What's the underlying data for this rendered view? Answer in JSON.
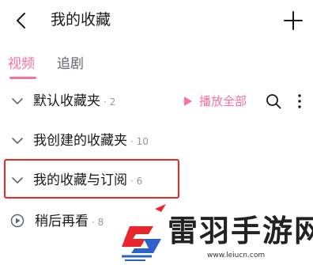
{
  "header": {
    "title": "我的收藏",
    "back_icon": "chevron-left-icon",
    "add_icon": "plus-icon"
  },
  "tabs": [
    {
      "label": "视频",
      "active": true
    },
    {
      "label": "追剧",
      "active": false
    }
  ],
  "folders": [
    {
      "name": "默认收藏夹",
      "count": "· 2",
      "expanded": false
    },
    {
      "name": "我创建的收藏夹",
      "count": "· 10",
      "expanded": false
    },
    {
      "name": "我的收藏与订阅",
      "count": "· 6",
      "expanded": false,
      "highlighted": true
    },
    {
      "name": "稍后再看",
      "count": "· 8",
      "icon": "play-circle-icon"
    }
  ],
  "actions": {
    "play_all_label": "播放全部",
    "search_icon": "search-icon",
    "more_icon": "more-vertical-icon"
  },
  "watermark": {
    "title": "雷羽手游网",
    "url": "www.leiucn.com"
  },
  "colors": {
    "accent": "#fb7299",
    "highlight_border": "#e8262b",
    "logo_red": "#e8262b",
    "logo_blue": "#2d63c8"
  }
}
